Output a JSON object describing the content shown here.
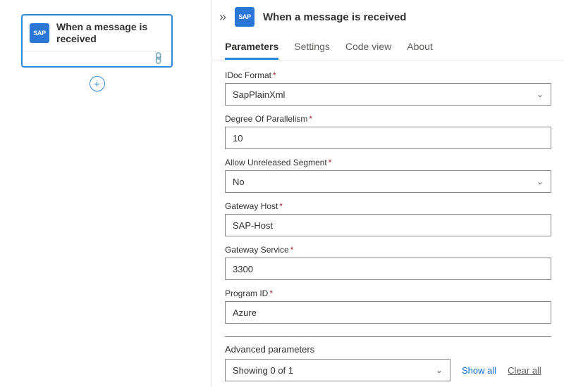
{
  "canvas": {
    "node": {
      "icon_text": "SAP",
      "title": "When a message is received"
    },
    "add_icon": "+"
  },
  "panel": {
    "collapse_glyph": "»",
    "icon_text": "SAP",
    "title": "When a message is received",
    "tabs": [
      {
        "label": "Parameters",
        "active": true
      },
      {
        "label": "Settings",
        "active": false
      },
      {
        "label": "Code view",
        "active": false
      },
      {
        "label": "About",
        "active": false
      }
    ],
    "fields": {
      "idoc_format": {
        "label": "IDoc Format",
        "required": true,
        "type": "select",
        "value": "SapPlainXml"
      },
      "parallelism": {
        "label": "Degree Of Parallelism",
        "required": true,
        "type": "text",
        "value": "10"
      },
      "allow_unreleased": {
        "label": "Allow Unreleased Segment",
        "required": true,
        "type": "select",
        "value": "No"
      },
      "gateway_host": {
        "label": "Gateway Host",
        "required": true,
        "type": "text",
        "value": "SAP-Host"
      },
      "gateway_service": {
        "label": "Gateway Service",
        "required": true,
        "type": "text",
        "value": "3300"
      },
      "program_id": {
        "label": "Program ID",
        "required": true,
        "type": "text",
        "value": "Azure"
      }
    },
    "advanced": {
      "heading": "Advanced parameters",
      "selector_text": "Showing 0 of 1",
      "show_all": "Show all",
      "clear_all": "Clear all"
    }
  }
}
